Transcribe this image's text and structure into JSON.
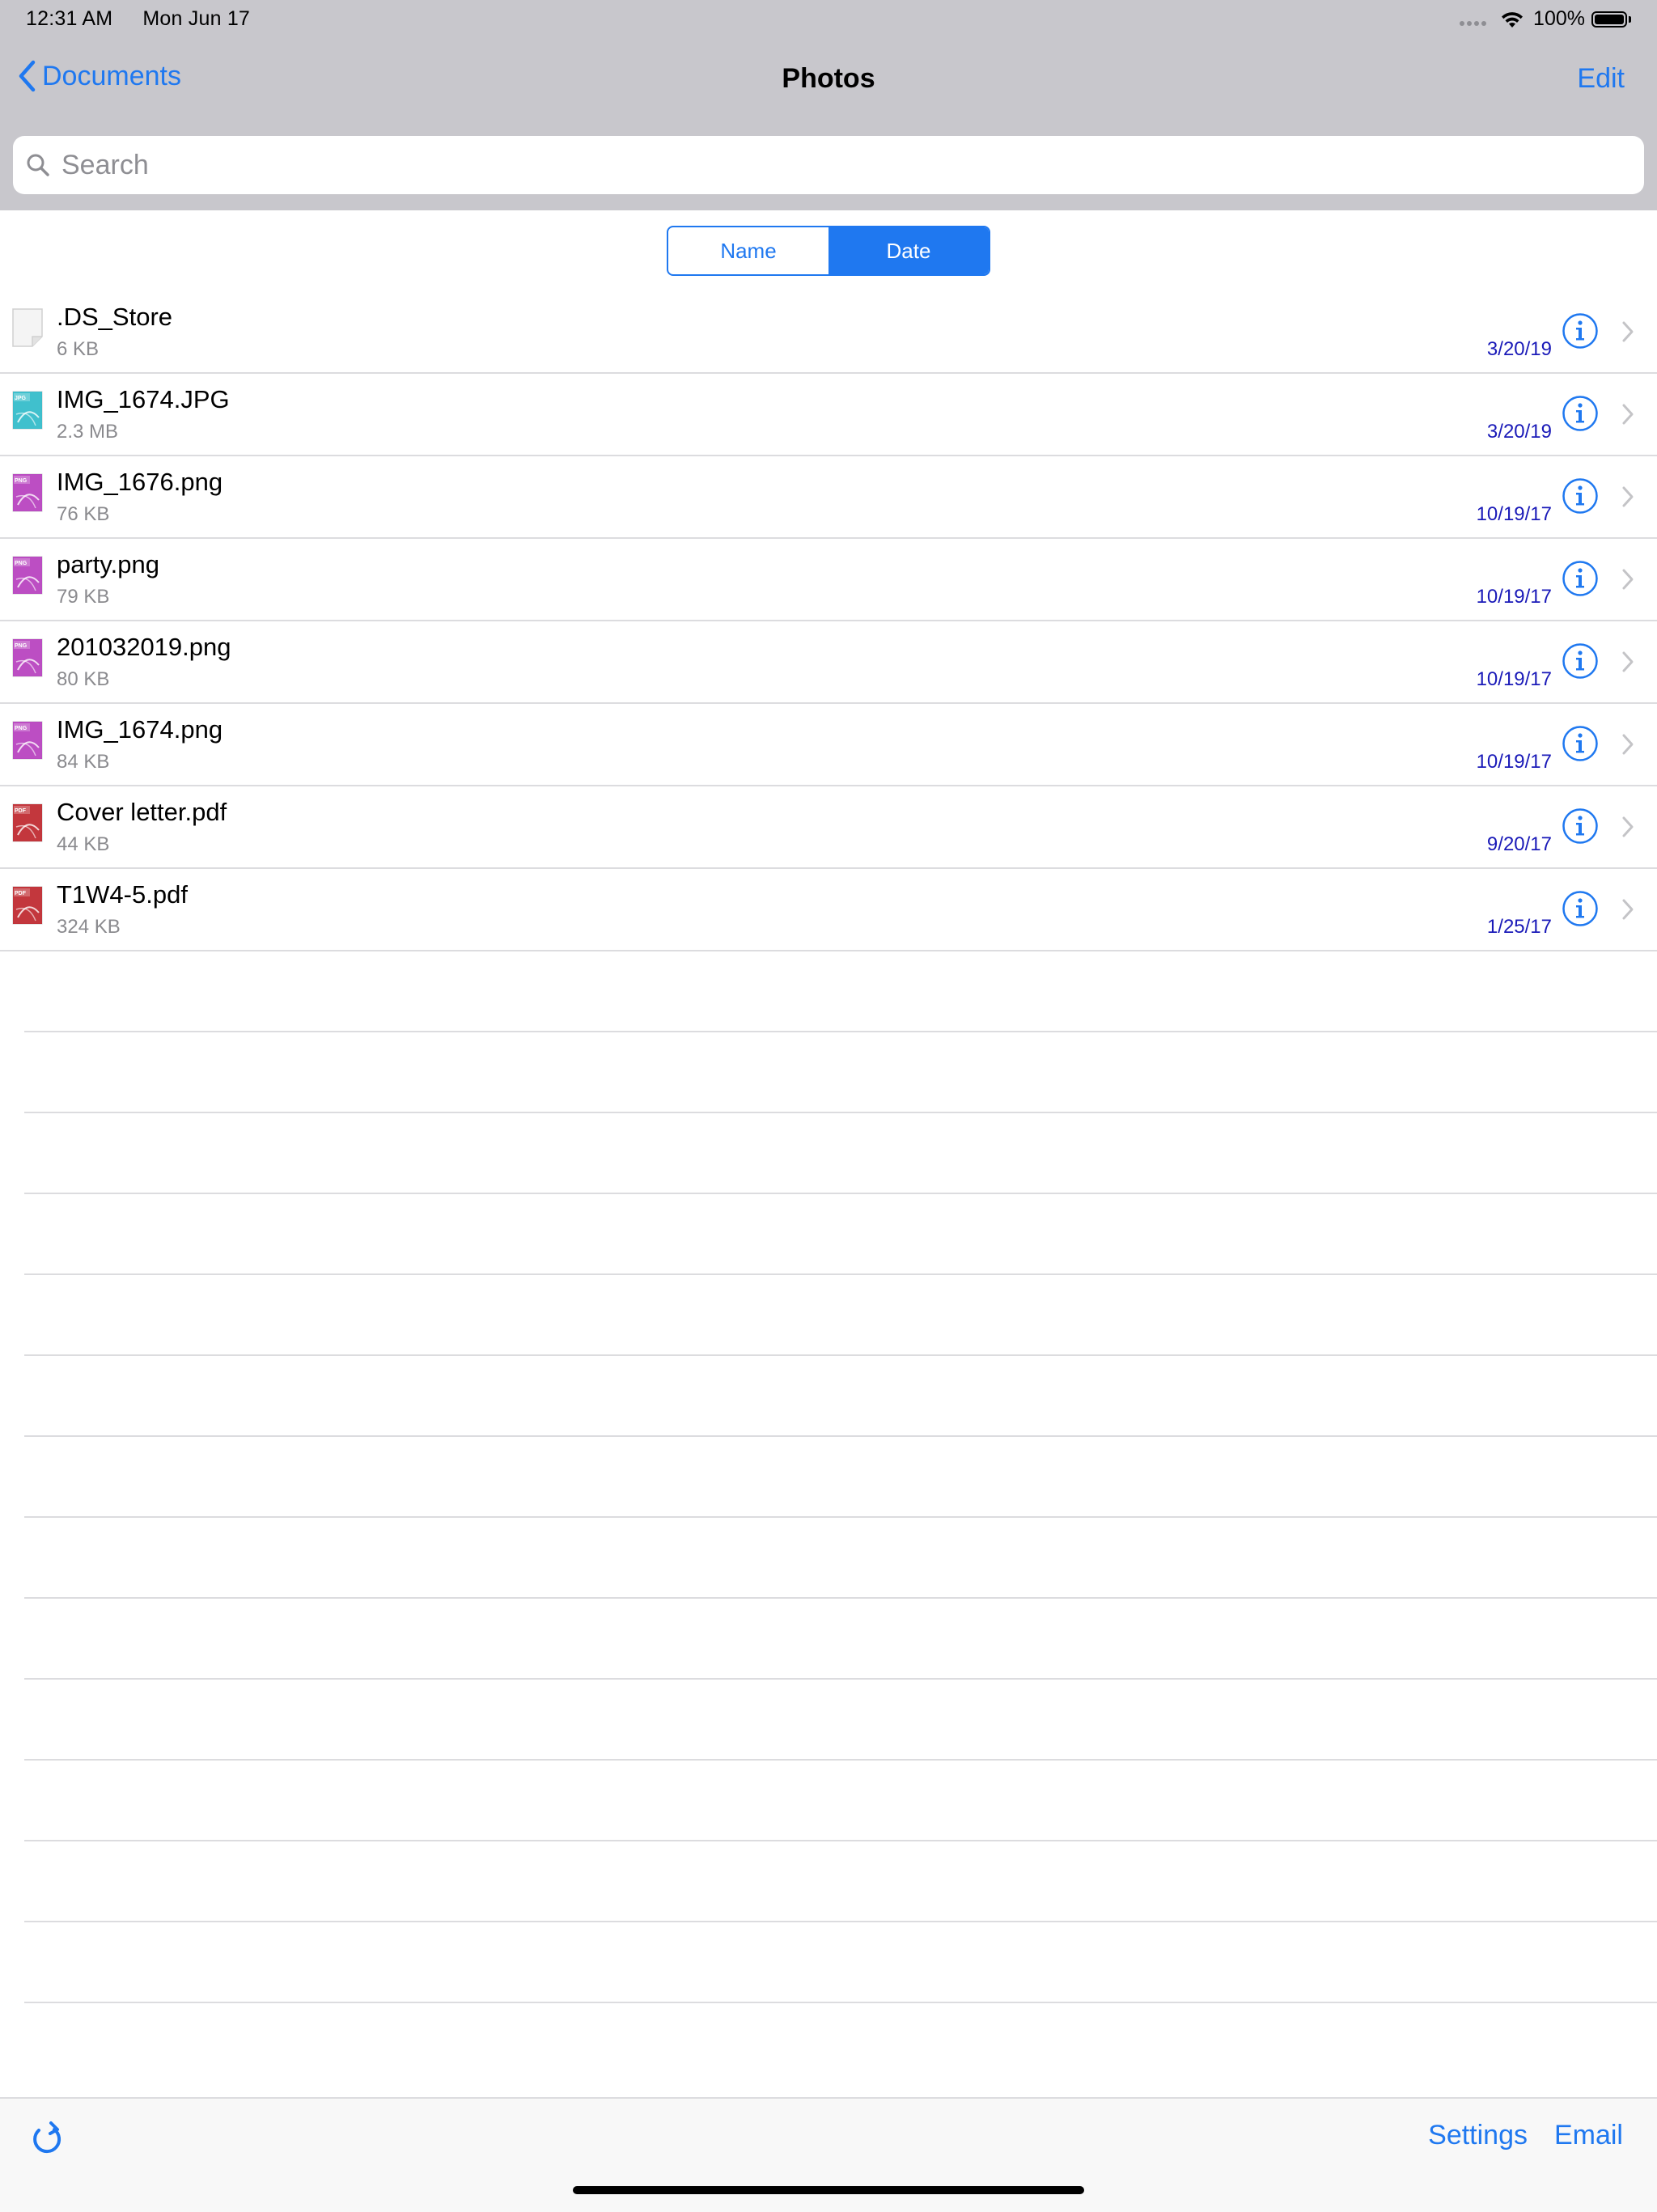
{
  "status_bar": {
    "time": "12:31 AM",
    "date": "Mon Jun 17",
    "battery": "100%"
  },
  "nav": {
    "back_label": "Documents",
    "title": "Photos",
    "edit_label": "Edit"
  },
  "search": {
    "placeholder": "Search"
  },
  "sort": {
    "options": [
      "Name",
      "Date"
    ],
    "selected": "Date"
  },
  "files": [
    {
      "name": ".DS_Store",
      "size": "6 KB",
      "date": "3/20/19",
      "icon": "generic-file-icon",
      "badge": ""
    },
    {
      "name": "IMG_1674.JPG",
      "size": "2.3 MB",
      "date": "3/20/19",
      "icon": "jpg-file-icon",
      "badge": "JPG"
    },
    {
      "name": "IMG_1676.png",
      "size": "76 KB",
      "date": "10/19/17",
      "icon": "png-file-icon",
      "badge": "PNG"
    },
    {
      "name": "party.png",
      "size": "79 KB",
      "date": "10/19/17",
      "icon": "png-file-icon",
      "badge": "PNG"
    },
    {
      "name": "201032019.png",
      "size": "80 KB",
      "date": "10/19/17",
      "icon": "png-file-icon",
      "badge": "PNG"
    },
    {
      "name": "IMG_1674.png",
      "size": "84 KB",
      "date": "10/19/17",
      "icon": "png-file-icon",
      "badge": "PNG"
    },
    {
      "name": "Cover letter.pdf",
      "size": "44 KB",
      "date": "9/20/17",
      "icon": "pdf-file-icon",
      "badge": "PDF"
    },
    {
      "name": "T1W4-5.pdf",
      "size": "324 KB",
      "date": "1/25/17",
      "icon": "pdf-file-icon",
      "badge": "PDF"
    }
  ],
  "toolbar": {
    "settings_label": "Settings",
    "email_label": "Email"
  },
  "colors": {
    "accent": "#1f78f0",
    "bar_gray": "#c8c7cc",
    "date_blue": "#1a1ab8",
    "jpg_teal": "#1fb5c4",
    "png_magenta": "#b02fb8",
    "pdf_red": "#b8141b"
  }
}
